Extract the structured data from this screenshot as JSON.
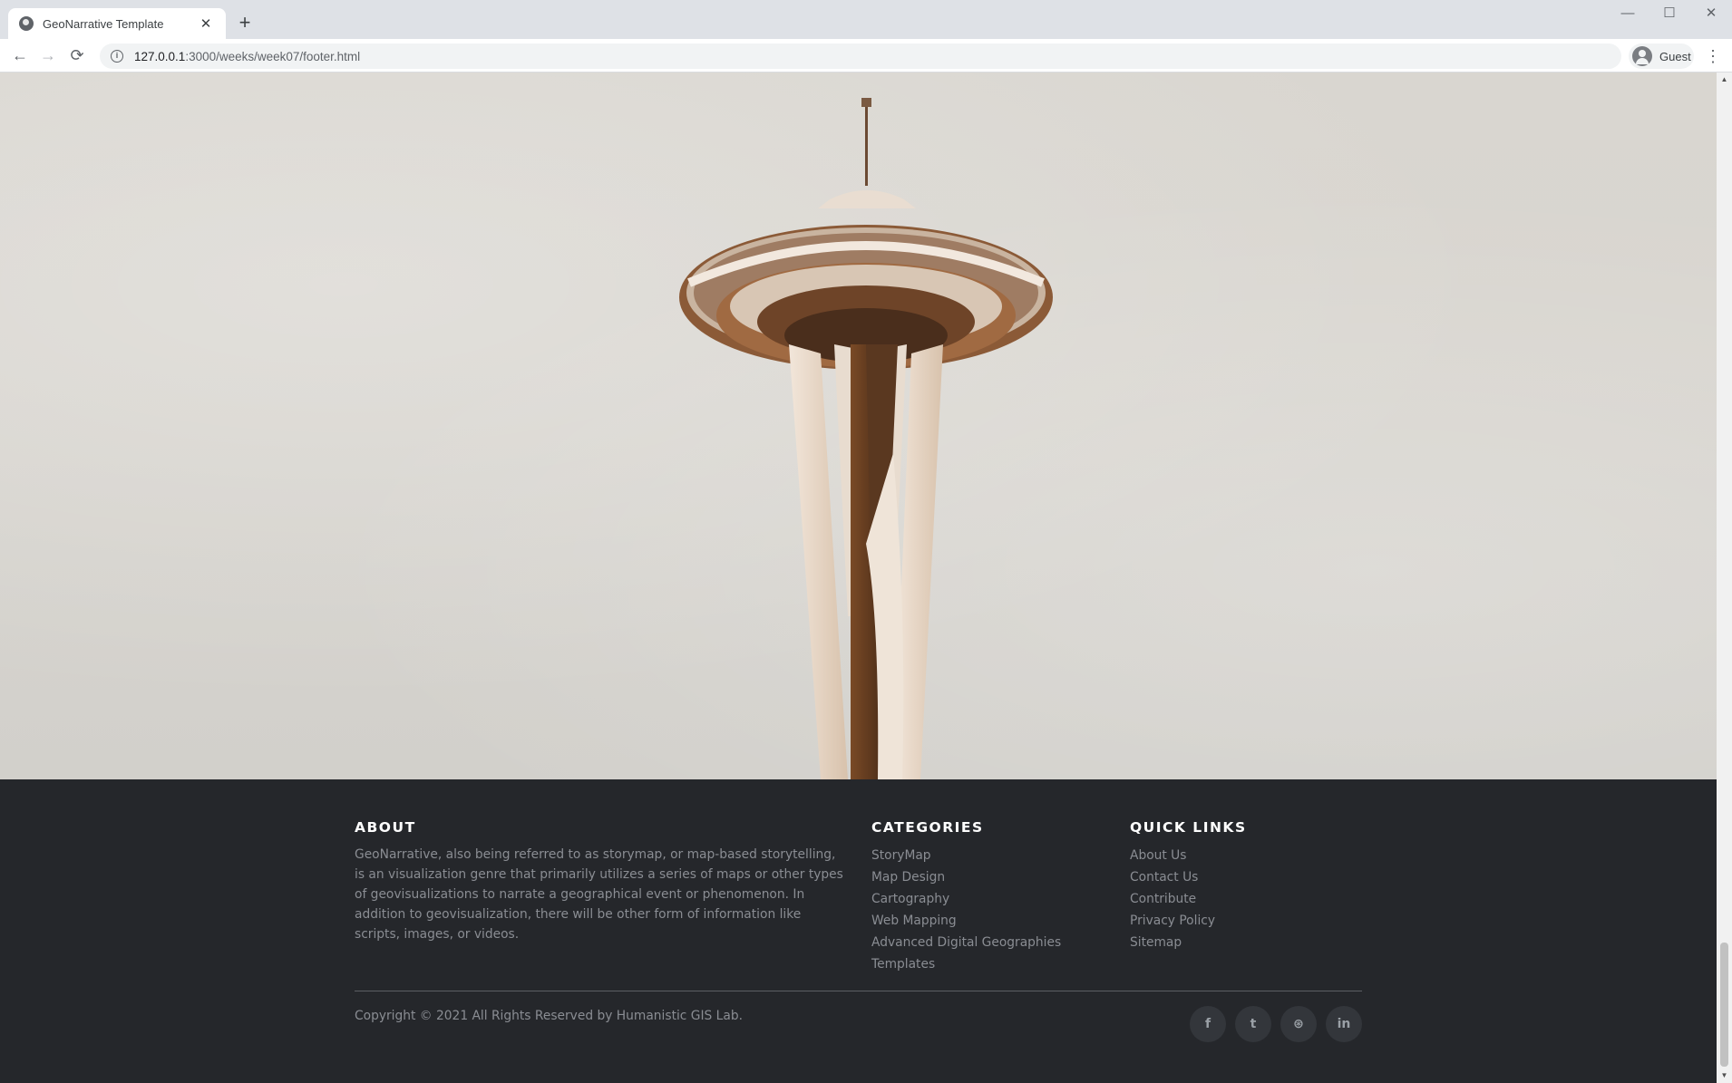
{
  "browser": {
    "tab_title": "GeoNarrative Template",
    "tab_close": "✕",
    "new_tab": "+",
    "url_host": "127.0.0.1",
    "url_path": ":3000/weeks/week07/footer.html",
    "profile_name": "Guest",
    "window_controls": {
      "minimize": "—",
      "maximize": "☐",
      "close": "✕"
    },
    "nav": {
      "back": "←",
      "forward": "→",
      "reload": "⟳",
      "menu": "⋮"
    }
  },
  "hero": {
    "image_subject": "space-needle-tower-photo"
  },
  "footer": {
    "about": {
      "heading": "ABOUT",
      "text": "GeoNarrative, also being referred to as storymap, or map-based storytelling, is an visualization genre that primarily utilizes a series of maps or other types of geovisualizations to narrate a geographical event or phenomenon. In addition to geovisualization, there will be other form of information like scripts, images, or videos."
    },
    "categories": {
      "heading": "CATEGORIES",
      "items": [
        "StoryMap",
        "Map Design",
        "Cartography",
        "Web Mapping",
        "Advanced Digital Geographies",
        "Templates"
      ]
    },
    "quick_links": {
      "heading": "QUICK LINKS",
      "items": [
        "About Us",
        "Contact Us",
        "Contribute",
        "Privacy Policy",
        "Sitemap"
      ]
    },
    "copyright": "Copyright © 2021 All Rights Reserved by Humanistic GIS Lab.",
    "social": [
      {
        "name": "facebook-icon",
        "glyph": "f"
      },
      {
        "name": "twitter-icon",
        "glyph": "t"
      },
      {
        "name": "dribbble-icon",
        "glyph": "⊛"
      },
      {
        "name": "linkedin-icon",
        "glyph": "in"
      }
    ]
  },
  "colors": {
    "footer_bg": "#25272b",
    "footer_text": "#8a8d93",
    "heading": "#ffffff"
  }
}
